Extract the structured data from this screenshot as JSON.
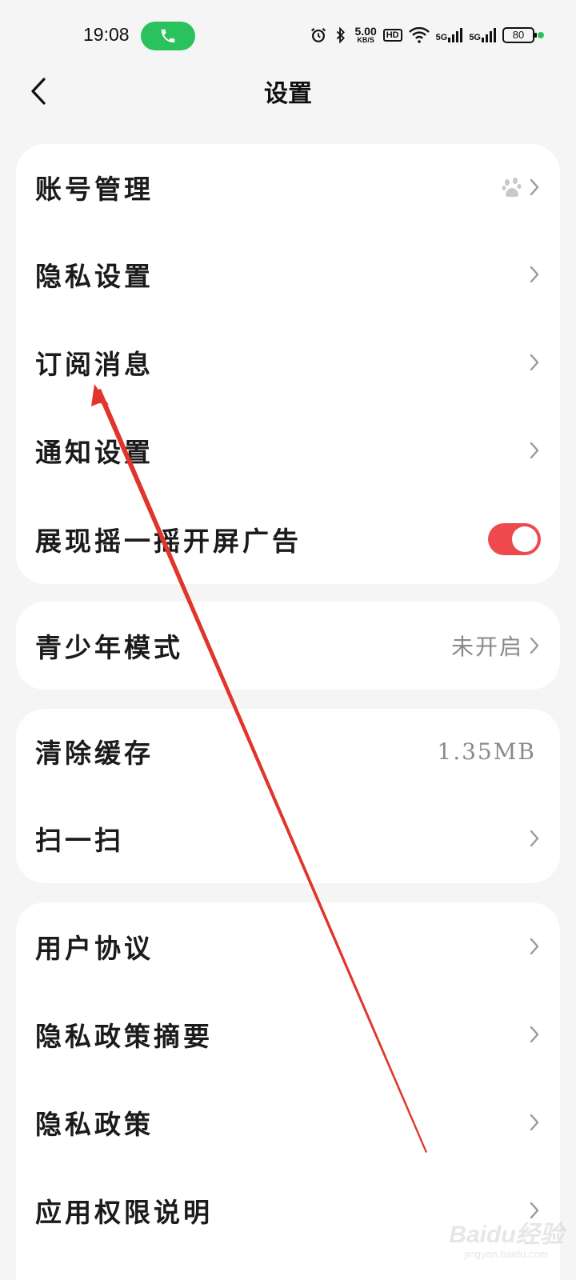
{
  "status_bar": {
    "time": "19:08",
    "speed_value": "5.00",
    "speed_unit": "KB/S",
    "hd_label": "HD",
    "network_a": "5G",
    "network_b": "5G",
    "battery": "80"
  },
  "header": {
    "title": "设置"
  },
  "groups": {
    "g1": {
      "account": {
        "label": "账号管理",
        "icon": "baidu-paw-icon"
      },
      "privacy": {
        "label": "隐私设置"
      },
      "subscribe": {
        "label": "订阅消息"
      },
      "notify": {
        "label": "通知设置"
      },
      "shake_ad": {
        "label": "展现摇一摇开屏广告",
        "enabled": true
      }
    },
    "g2": {
      "teen": {
        "label": "青少年模式",
        "value": "未开启"
      }
    },
    "g3": {
      "cache": {
        "label": "清除缓存",
        "value": "1.35MB"
      },
      "scan": {
        "label": "扫一扫"
      }
    },
    "g4": {
      "agreement": {
        "label": "用户协议"
      },
      "policy_summary": {
        "label": "隐私政策摘要"
      },
      "policy": {
        "label": "隐私政策"
      },
      "permissions": {
        "label": "应用权限说明"
      }
    }
  },
  "watermark": {
    "main": "Baidu经验",
    "sub": "jingyan.baidu.com"
  },
  "colors": {
    "accent_red": "#ee4a4d",
    "call_green": "#2ac25c",
    "background": "#f5f5f5"
  }
}
